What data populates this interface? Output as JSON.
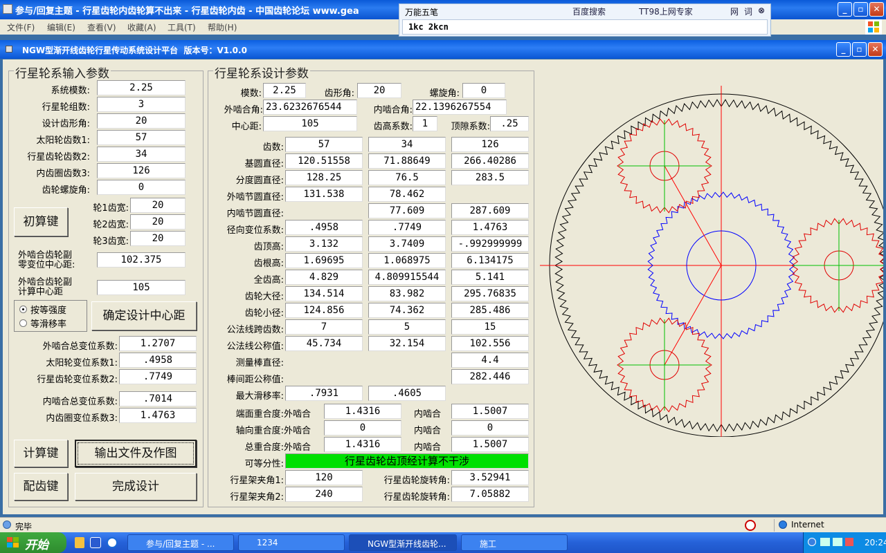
{
  "browser": {
    "title": "参与/回复主题 - 行星齿轮内齿轮算不出来 - 行星齿轮内齿 - 中国齿轮论坛 www.gea",
    "menu": [
      "文件(F)",
      "编辑(E)",
      "查看(V)",
      "收藏(A)",
      "工具(T)",
      "帮助(H)"
    ]
  },
  "ime": {
    "name": "万能五笔",
    "baidu": "百度搜索",
    "expert": "TT98上网专家",
    "web": "网",
    "word": "词",
    "input": "1kc 2kcn"
  },
  "app": {
    "title": "NGW型渐开线齿轮行星传动系统设计平台  版本号：V1.0.0"
  },
  "input_panel": {
    "title": "行星轮系输入参数",
    "fields": [
      {
        "label": "系统模数:",
        "value": "2.25"
      },
      {
        "label": "行星轮组数:",
        "value": "3"
      },
      {
        "label": "设计齿形角:",
        "value": "20"
      },
      {
        "label": "太阳轮齿数1:",
        "value": "57"
      },
      {
        "label": "行星齿轮齿数2:",
        "value": "34"
      },
      {
        "label": "内齿圈齿数3:",
        "value": "126"
      },
      {
        "label": "齿轮螺旋角:",
        "value": "0"
      }
    ],
    "widths": [
      {
        "label": "轮1齿宽:",
        "value": "20"
      },
      {
        "label": "轮2齿宽:",
        "value": "20"
      },
      {
        "label": "轮3齿宽:",
        "value": "20"
      }
    ],
    "init_button": "初算键",
    "zero_center_label_1": "外啮合齿轮副",
    "zero_center_label_2": "零变位中心距:",
    "zero_center_value": "102.375",
    "calc_center_label_1": "外啮合齿轮副",
    "calc_center_label_2": "计算中心距",
    "calc_center_value": "105",
    "radio_strength": "按等强度",
    "radio_slip": "等滑移率",
    "confirm_button": "确定设计中心距",
    "shift": [
      {
        "label": "外啮合总变位系数:",
        "value": "1.2707"
      },
      {
        "label": "太阳轮变位系数1:",
        "value": ".4958"
      },
      {
        "label": "行星齿轮变位系数2:",
        "value": ".7749"
      }
    ],
    "shift2": [
      {
        "label": "内啮合总变位系数:",
        "value": ".7014"
      },
      {
        "label": "内齿圈变位系数3:",
        "value": "1.4763"
      }
    ],
    "calc_button": "计算键",
    "export_button": "输出文件及作图",
    "match_button": "配齿键",
    "finish_button": "完成设计"
  },
  "design_panel": {
    "title": "行星轮系设计参数",
    "module_label": "模数:",
    "module": "2.25",
    "pressure_label": "齿形角:",
    "pressure": "20",
    "helix_label": "螺旋角:",
    "helix": "0",
    "ext_angle_label": "外啮合角:",
    "ext_angle": "23.6232676544",
    "int_angle_label": "内啮合角:",
    "int_angle": "22.1396267554",
    "center_label": "中心距:",
    "center": "105",
    "addendum_coef_label": "齿高系数:",
    "addendum_coef": "1",
    "clearance_label": "顶隙系数:",
    "clearance": ".25",
    "rows": [
      {
        "label": "齿数:",
        "v": [
          "57",
          "34",
          "126"
        ]
      },
      {
        "label": "基圆直径:",
        "v": [
          "120.51558",
          "71.88649",
          "266.40286"
        ]
      },
      {
        "label": "分度圆直径:",
        "v": [
          "128.25",
          "76.5",
          "283.5"
        ]
      },
      {
        "label": "外啮节圆直径:",
        "v": [
          "131.538",
          "78.462",
          ""
        ]
      },
      {
        "label": "内啮节圆直径:",
        "v": [
          "",
          "77.609",
          "287.609"
        ]
      },
      {
        "label": "径向变位系数:",
        "v": [
          ".4958",
          ".7749",
          "1.4763"
        ]
      },
      {
        "label": "齿顶高:",
        "v": [
          "3.132",
          "3.7409",
          "-.992999999"
        ]
      },
      {
        "label": "齿根高:",
        "v": [
          "1.69695",
          "1.068975",
          "6.134175"
        ]
      },
      {
        "label": "全齿高:",
        "v": [
          "4.829",
          "4.809915544",
          "5.141"
        ]
      },
      {
        "label": "齿轮大径:",
        "v": [
          "134.514",
          "83.982",
          "295.76835"
        ]
      },
      {
        "label": "齿轮小径:",
        "v": [
          "124.856",
          "74.362",
          "285.486"
        ]
      },
      {
        "label": "公法线跨齿数:",
        "v": [
          "7",
          "5",
          "15"
        ]
      },
      {
        "label": "公法线公称值:",
        "v": [
          "45.734",
          "32.154",
          "102.556"
        ]
      },
      {
        "label": "测量棒直径:",
        "v": [
          "",
          "",
          "4.4"
        ]
      },
      {
        "label": "棒间距公称值:",
        "v": [
          "",
          "",
          "282.446"
        ]
      },
      {
        "label": "最大滑移率:",
        "v": [
          ".7931",
          ".4605",
          ""
        ]
      }
    ],
    "contact": [
      {
        "label": "端面重合度:",
        "ext_label": "外啮合",
        "ext": "1.4316",
        "int_label": "内啮合",
        "int": "1.5007"
      },
      {
        "label": "轴向重合度:",
        "ext_label": "外啮合",
        "ext": "0",
        "int_label": "内啮合",
        "int": "0"
      },
      {
        "label": "总重合度:",
        "ext_label": "外啮合",
        "ext": "1.4316",
        "int_label": "内啮合",
        "int": "1.5007"
      }
    ],
    "divisible_label": "可等分性:",
    "divisible_status": "行星齿轮齿顶经计算不干涉",
    "carrier": [
      {
        "label": "行星架夹角1:",
        "value": "120",
        "rot_label": "行星齿轮旋转角:",
        "rot": "3.52941"
      },
      {
        "label": "行星架夹角2:",
        "value": "240",
        "rot_label": "行星齿轮旋转角:",
        "rot": "7.05882"
      }
    ]
  },
  "gear_drawing": {
    "sun_teeth": 57,
    "planet_teeth": 34,
    "ring_teeth": 126,
    "planet_count": 3,
    "sun_color": "#0000ff",
    "planet_color": "#e00000",
    "ring_color": "#000000",
    "axis_color": "#ff0000",
    "planet_axis_color": "#00c000"
  },
  "statusbar": {
    "text": "完毕",
    "zone": "Internet"
  },
  "taskbar": {
    "start": "开始",
    "tasks": [
      "参与/回复主题 - ...",
      "1234",
      "NGW型渐开线齿轮...",
      "施工"
    ],
    "clock": "20:24"
  }
}
